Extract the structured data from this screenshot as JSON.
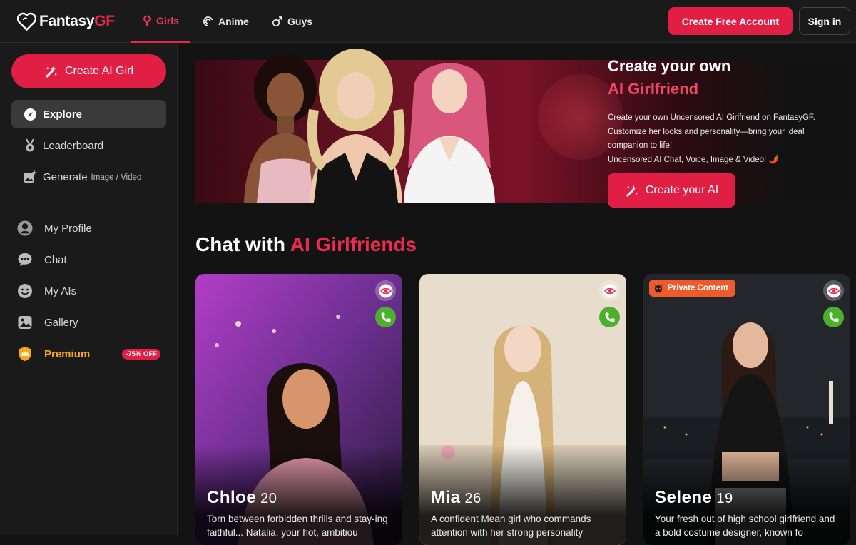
{
  "brand": {
    "name_main": "Fantasy",
    "name_accent": "GF",
    "accent": "#e11f45"
  },
  "nav": {
    "tabs": [
      {
        "label": "Girls",
        "icon": "female-icon",
        "active": true
      },
      {
        "label": "Anime",
        "icon": "swirl-icon",
        "active": false
      },
      {
        "label": "Guys",
        "icon": "male-icon",
        "active": false
      }
    ],
    "create_account": "Create Free Account",
    "sign_in": "Sign in"
  },
  "sidebar": {
    "create_button": "Create AI Girl",
    "items": [
      {
        "label": "Explore",
        "icon": "compass-icon",
        "active": true
      },
      {
        "label": "Leaderboard",
        "icon": "medal-icon"
      },
      {
        "label": "Generate",
        "sub": "Image / Video",
        "icon": "image-sparkle-icon"
      }
    ],
    "account_items": [
      {
        "label": "My Profile",
        "icon": "profile-icon"
      },
      {
        "label": "Chat",
        "icon": "chat-icon"
      },
      {
        "label": "My AIs",
        "icon": "smile-icon"
      },
      {
        "label": "Gallery",
        "icon": "gallery-icon"
      }
    ],
    "premium": {
      "label": "Premium",
      "badge": "-75% OFF",
      "icon": "crown-shield-icon"
    }
  },
  "hero": {
    "title_line1": "Create your own",
    "title_line2": "AI Girlfriend",
    "desc_1": "Create your own Uncensored AI Girlfriend on FantasyGF.",
    "desc_2": "Customize her looks and personality—bring your ideal companion to life!",
    "desc_3": "Uncensored AI Chat, Voice, Image & Video! 🌶️",
    "button": "Create your AI"
  },
  "section": {
    "title_plain": "Chat with ",
    "title_accent": "AI Girlfriends"
  },
  "cards": [
    {
      "name": "Chloe",
      "age": "20",
      "desc": "Torn between forbidden thrills and stay-ing faithful... Natalia, your hot, ambitiou",
      "private": false
    },
    {
      "name": "Mia",
      "age": "26",
      "desc": "A confident Mean girl who commands attention with her strong personality",
      "private": false
    },
    {
      "name": "Selene",
      "age": "19",
      "desc": "Your fresh out of high school girlfriend and a bold costume designer, known fo",
      "private": true,
      "private_label": "Private Content"
    }
  ]
}
